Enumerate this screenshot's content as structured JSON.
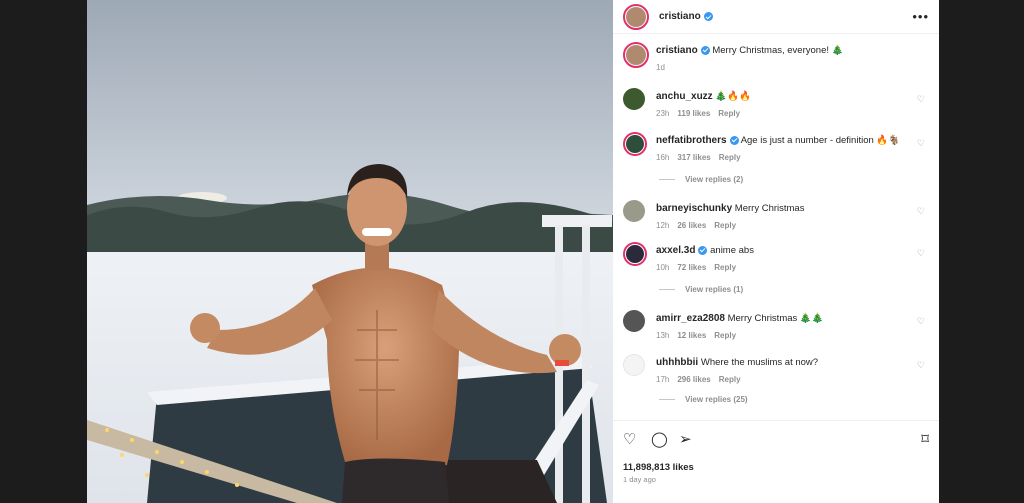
{
  "post": {
    "author": "cristiano",
    "caption": "Merry Christmas, everyone! 🎄",
    "caption_time": "1d",
    "likes": "11,898,813 likes",
    "posted": "1 day ago",
    "more_icon": "more-horizontal-icon"
  },
  "comments": [
    {
      "user": "anchu_xuzz",
      "text": "🎄🔥🔥",
      "time": "23h",
      "likes": "119 likes",
      "reply": "Reply",
      "verified": false,
      "avatar": "#3c5a2e"
    },
    {
      "user": "neffatibrothers",
      "text": "Age is just a number - definition 🔥🐐",
      "time": "16h",
      "likes": "317 likes",
      "reply": "Reply",
      "verified": true,
      "avatar": "#2e4d3a"
    },
    {
      "user": "barneyischunky",
      "text": "Merry Christmas",
      "time": "12h",
      "likes": "26 likes",
      "reply": "Reply",
      "verified": false,
      "avatar": "#9a9a8a"
    },
    {
      "user": "axxel.3d",
      "text": "anime abs",
      "time": "10h",
      "likes": "72 likes",
      "reply": "Reply",
      "verified": true,
      "avatar": "#2a2a3a"
    },
    {
      "user": "amirr_eza2808",
      "text": "Merry Christmas 🎄🎄",
      "time": "13h",
      "likes": "12 likes",
      "reply": "Reply",
      "verified": false,
      "avatar": "#555555"
    },
    {
      "user": "uhhhbbii",
      "text": "Where the muslims at now?",
      "time": "17h",
      "likes": "296 likes",
      "reply": "Reply",
      "verified": false,
      "avatar": "#f4f4f4"
    }
  ],
  "view_replies": [
    "View replies (2)",
    "View replies (1)",
    "View replies (25)"
  ],
  "actions": {
    "like": "heart-icon",
    "comment": "comment-icon",
    "share": "send-icon",
    "save": "bookmark-icon"
  }
}
